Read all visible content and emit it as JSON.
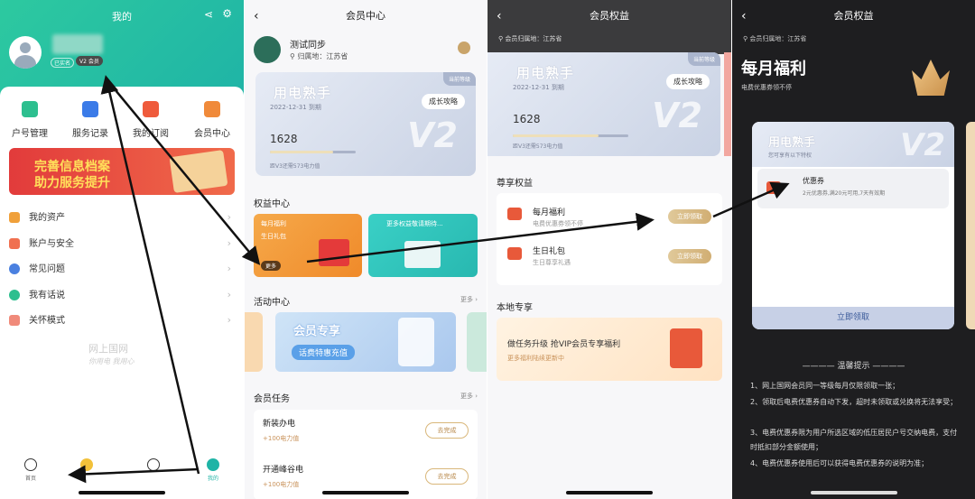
{
  "p1": {
    "title": "我的",
    "membership_tag": "V2 会员",
    "real_name_tag": "已实名",
    "services": [
      "户号管理",
      "服务记录",
      "我的订阅",
      "会员中心"
    ],
    "banner": {
      "line1": "完善信息档案",
      "line2": "助力服务提升"
    },
    "menu": [
      "我的资产",
      "账户与安全",
      "常见问题",
      "我有话说",
      "关怀模式"
    ],
    "watermark": "网上国网",
    "watermark_sub": "你用电 我用心",
    "tabs": [
      "首页",
      "",
      "",
      "我的"
    ]
  },
  "p2": {
    "title": "会员中心",
    "user_name": "测试同步",
    "region": "归属地：江苏省",
    "vip": {
      "brand": "用电熟手",
      "date": "2022-12-31 到期",
      "level_tag": "当前等级",
      "grow_btn": "成长攻略",
      "points": "1628",
      "next_level": "距V3还需573电力值",
      "mark": "V2",
      "progress": 0.74
    },
    "benefit_title": "权益中心",
    "benefit_items": [
      "每月福利",
      "生日礼包"
    ],
    "benefit_more": "更多",
    "benefit_teaser": "更多权益敬请期待...",
    "activity_title": "活动中心",
    "more_label": "更多",
    "promo": {
      "title": "会员专享",
      "sub": "话费特惠充值"
    },
    "task_title": "会员任务",
    "tasks": [
      {
        "name": "新装办电",
        "reward": "+100电力值",
        "btn": "去完成"
      },
      {
        "name": "开通峰谷电",
        "reward": "+100电力值",
        "btn": "去完成"
      }
    ]
  },
  "p3": {
    "title": "会员权益",
    "region": "会员归属地：江苏省",
    "vip": {
      "brand": "用电熟手",
      "date": "2022-12-31 到期",
      "level_tag": "当前等级",
      "grow_btn": "成长攻略",
      "points": "1628",
      "next_level": "距V3还需573电力值",
      "mark": "V2",
      "progress": 0.74
    },
    "exclusive_title": "尊享权益",
    "rights": [
      {
        "name": "每月福利",
        "desc": "电费优惠券领不停",
        "btn": "立即领取"
      },
      {
        "name": "生日礼包",
        "desc": "生日尊享礼遇",
        "btn": "立即领取"
      }
    ],
    "local_title": "本地专享",
    "local_main": "做任务升级 抢VIP会员专享福利",
    "local_sub": "更多福利陆续更新中"
  },
  "p4": {
    "title": "会员权益",
    "region": "会员归属地：江苏省",
    "hero_title": "每月福利",
    "hero_sub": "电费优惠券领不停",
    "card_brand": "用电熟手",
    "card_sub": "您可享有以下特权",
    "coupon_name": "优惠券",
    "coupon_desc": "2元优惠券,满20元可用,7天有效期",
    "claim_btn": "立即领取",
    "tips_title": "温馨提示",
    "tips": [
      "1、网上国网会员同一等级每月仅限领取一张；",
      "2、领取后电费优惠券自动下发，超时未领取或兑换将无法享受；",
      "3、电费优惠券限为用户所选区域的低压居民户号交纳电费，支付时抵扣部分金额使用；",
      "4、电费优惠券使用后可以获得电费优惠券的说明为准；"
    ]
  },
  "colors": {
    "teal": "#1fb4a6",
    "gold": "#d1ae73",
    "red": "#e23b3b",
    "dark": "#1e1e20"
  }
}
